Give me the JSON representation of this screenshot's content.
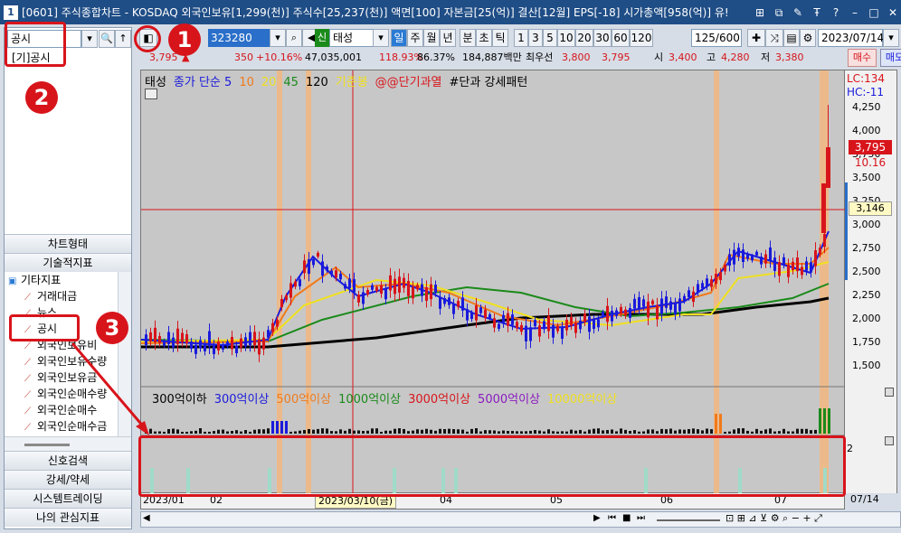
{
  "window": {
    "title": "[0601] 주식종합차트 - KOSDAQ 외국인보유[1,299(천)] 주식수[25,237(천)] 액면[100] 자본금[25(억)] 결산[12월] EPS[-18] 시가총액[958(억)] 유!",
    "icon_label": "1",
    "controls": [
      "⊞",
      "⧉",
      "✎",
      "Ŧ",
      "?",
      "–",
      "□",
      "✕"
    ]
  },
  "left_panel": {
    "search_value": "공시",
    "search_button": "🔍",
    "up_button": "↑",
    "result_item": "[기]공시",
    "nav_top": [
      "차트형태",
      "기술적지표"
    ],
    "tree": {
      "folder": "기타지표",
      "items": [
        "거래대금",
        "뉴스",
        "공시",
        "외국인보유비",
        "외국인보유수량",
        "외국인보유금",
        "외국인순매수량",
        "외국인순매수",
        "외국인순매수금"
      ]
    },
    "nav_bottom": [
      "신호검색",
      "강세/약세",
      "시스템트레이딩",
      "나의 관심지표"
    ]
  },
  "toolbar": {
    "code": "323280",
    "badge": "신",
    "stock_name": "태성",
    "periods": [
      "일",
      "주",
      "월",
      "년",
      "분",
      "초",
      "틱"
    ],
    "numbers": [
      "1",
      "3",
      "5",
      "10",
      "20",
      "30",
      "60",
      "120"
    ],
    "count": "125/600",
    "date": "2023/07/14"
  },
  "quote": {
    "price": "3,795",
    "change": "350",
    "change_pct": "+10.16%",
    "volume": "47,035,001",
    "vol_ratio": "118.93%",
    "pct2": "86.37%",
    "amount": "184,887백만",
    "priority_label": "최우선",
    "ask": "3,800",
    "bid": "3,795",
    "open_label": "시",
    "open": "3,400",
    "high_label": "고",
    "high": "4,280",
    "low_label": "저",
    "low": "3,380",
    "buy": "매수",
    "sell": "매도"
  },
  "chart": {
    "legend": [
      {
        "text": "태성",
        "color": "#000000"
      },
      {
        "text": "종가 단순 5",
        "color": "#1a1adc"
      },
      {
        "text": "10",
        "color": "#f07a1a"
      },
      {
        "text": "20",
        "color": "#f0e020"
      },
      {
        "text": "45",
        "color": "#1a8a1a"
      },
      {
        "text": "120",
        "color": "#000000"
      },
      {
        "text": "기준봉",
        "color": "#f0e020"
      },
      {
        "text": "@@단기과열",
        "color": "#d8141b"
      },
      {
        "text": "#단과 강세패턴",
        "color": "#000000"
      }
    ],
    "volume_legend": [
      {
        "text": "300억이하",
        "color": "#000000"
      },
      {
        "text": "300억이상",
        "color": "#1a1adc"
      },
      {
        "text": "500억이상",
        "color": "#f07a1a"
      },
      {
        "text": "1000억이상",
        "color": "#1a8a1a"
      },
      {
        "text": "3000억이상",
        "color": "#d8141b"
      },
      {
        "text": "5000억이상",
        "color": "#8a1ac0"
      },
      {
        "text": "10000억이상",
        "color": "#f0e020"
      }
    ],
    "lc": "LC:134",
    "hc": "HC:-11",
    "price_tag": "3,795",
    "pct_tag": "10.16",
    "cross_tag": "3,146",
    "y_ticks": [
      "4,250",
      "4,000",
      "3,750",
      "3,500",
      "3,250",
      "3,000",
      "2,750",
      "2,500",
      "2,250",
      "2,000",
      "1,750",
      "1,500"
    ],
    "sub_tick": "2",
    "x_ticks": [
      "2023/01",
      "02",
      "03",
      "04",
      "05",
      "06",
      "07"
    ],
    "x_cross": "2023/03/10(금)",
    "x_end": "07/14"
  },
  "annotations": [
    "1",
    "2",
    "3"
  ]
}
